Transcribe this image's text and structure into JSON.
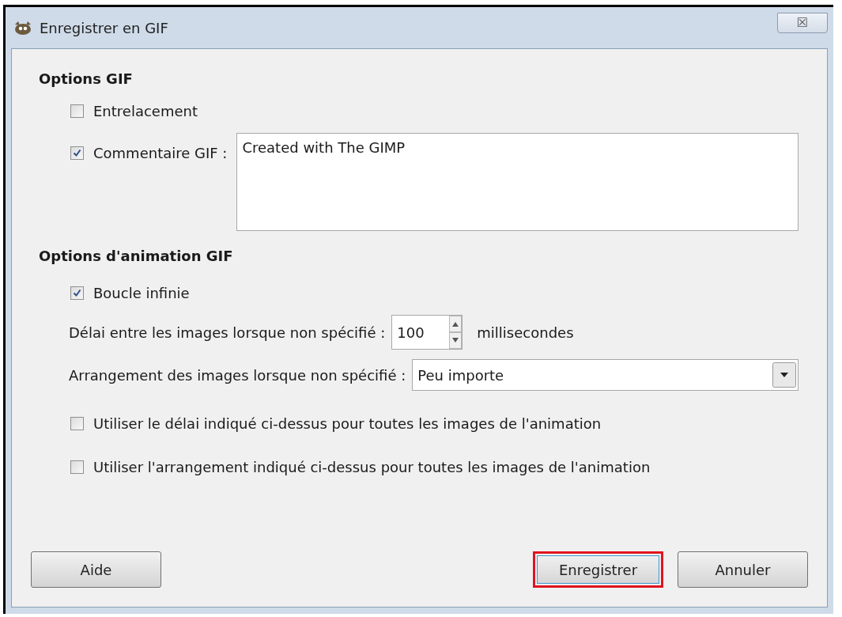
{
  "window": {
    "title": "Enregistrer en GIF",
    "close": "☒"
  },
  "gif_options": {
    "heading": "Options GIF",
    "interlace": {
      "label": "Entrelacement",
      "checked": false
    },
    "comment": {
      "label": "Commentaire GIF :",
      "checked": true,
      "value": "Created with The GIMP"
    }
  },
  "animation_options": {
    "heading": "Options d'animation GIF",
    "loop": {
      "label": "Boucle infinie",
      "checked": true
    },
    "delay": {
      "label": "Délai entre les images lorsque non spécifié :",
      "value": "100",
      "unit": "millisecondes"
    },
    "disposal": {
      "label": "Arrangement des images lorsque non spécifié :",
      "value": "Peu importe"
    },
    "checks": [
      {
        "label": "Utiliser le délai indiqué ci-dessus pour toutes les images de l'animation",
        "checked": false
      },
      {
        "label": "Utiliser l'arrangement indiqué ci-dessus pour toutes les images de l'animation",
        "checked": false
      }
    ]
  },
  "buttons": {
    "left": [
      {
        "label": "Aide",
        "highlighted": false
      }
    ],
    "right": [
      {
        "label": "Enregistrer",
        "highlighted": true
      },
      {
        "label": "Annuler",
        "highlighted": false
      }
    ]
  }
}
